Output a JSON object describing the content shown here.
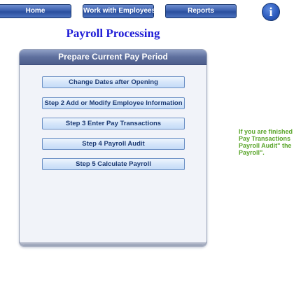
{
  "nav": {
    "home_label": "Home",
    "employees_label": "Work with Employees",
    "reports_label": "Reports",
    "info_glyph": "i"
  },
  "page_title": "Payroll Processing",
  "panel": {
    "title": "Prepare Current Pay Period",
    "buttons": [
      "Change Dates after Opening",
      "Step 2 Add or Modify Employee Information",
      "Step 3 Enter Pay Transactions",
      "Step 4 Payroll Audit",
      "Step 5 Calculate Payroll"
    ]
  },
  "help_text": {
    "lines": [
      "If you are finished",
      "Pay Transactions",
      "Payroll Audit\" the",
      "Payroll\"."
    ]
  },
  "colors": {
    "title": "#1d1ad6",
    "help_text": "#5aa52a",
    "nav_button": "#3a5fae",
    "panel_header": "#5e6f9d"
  },
  "icons": {
    "info": "info-icon"
  }
}
